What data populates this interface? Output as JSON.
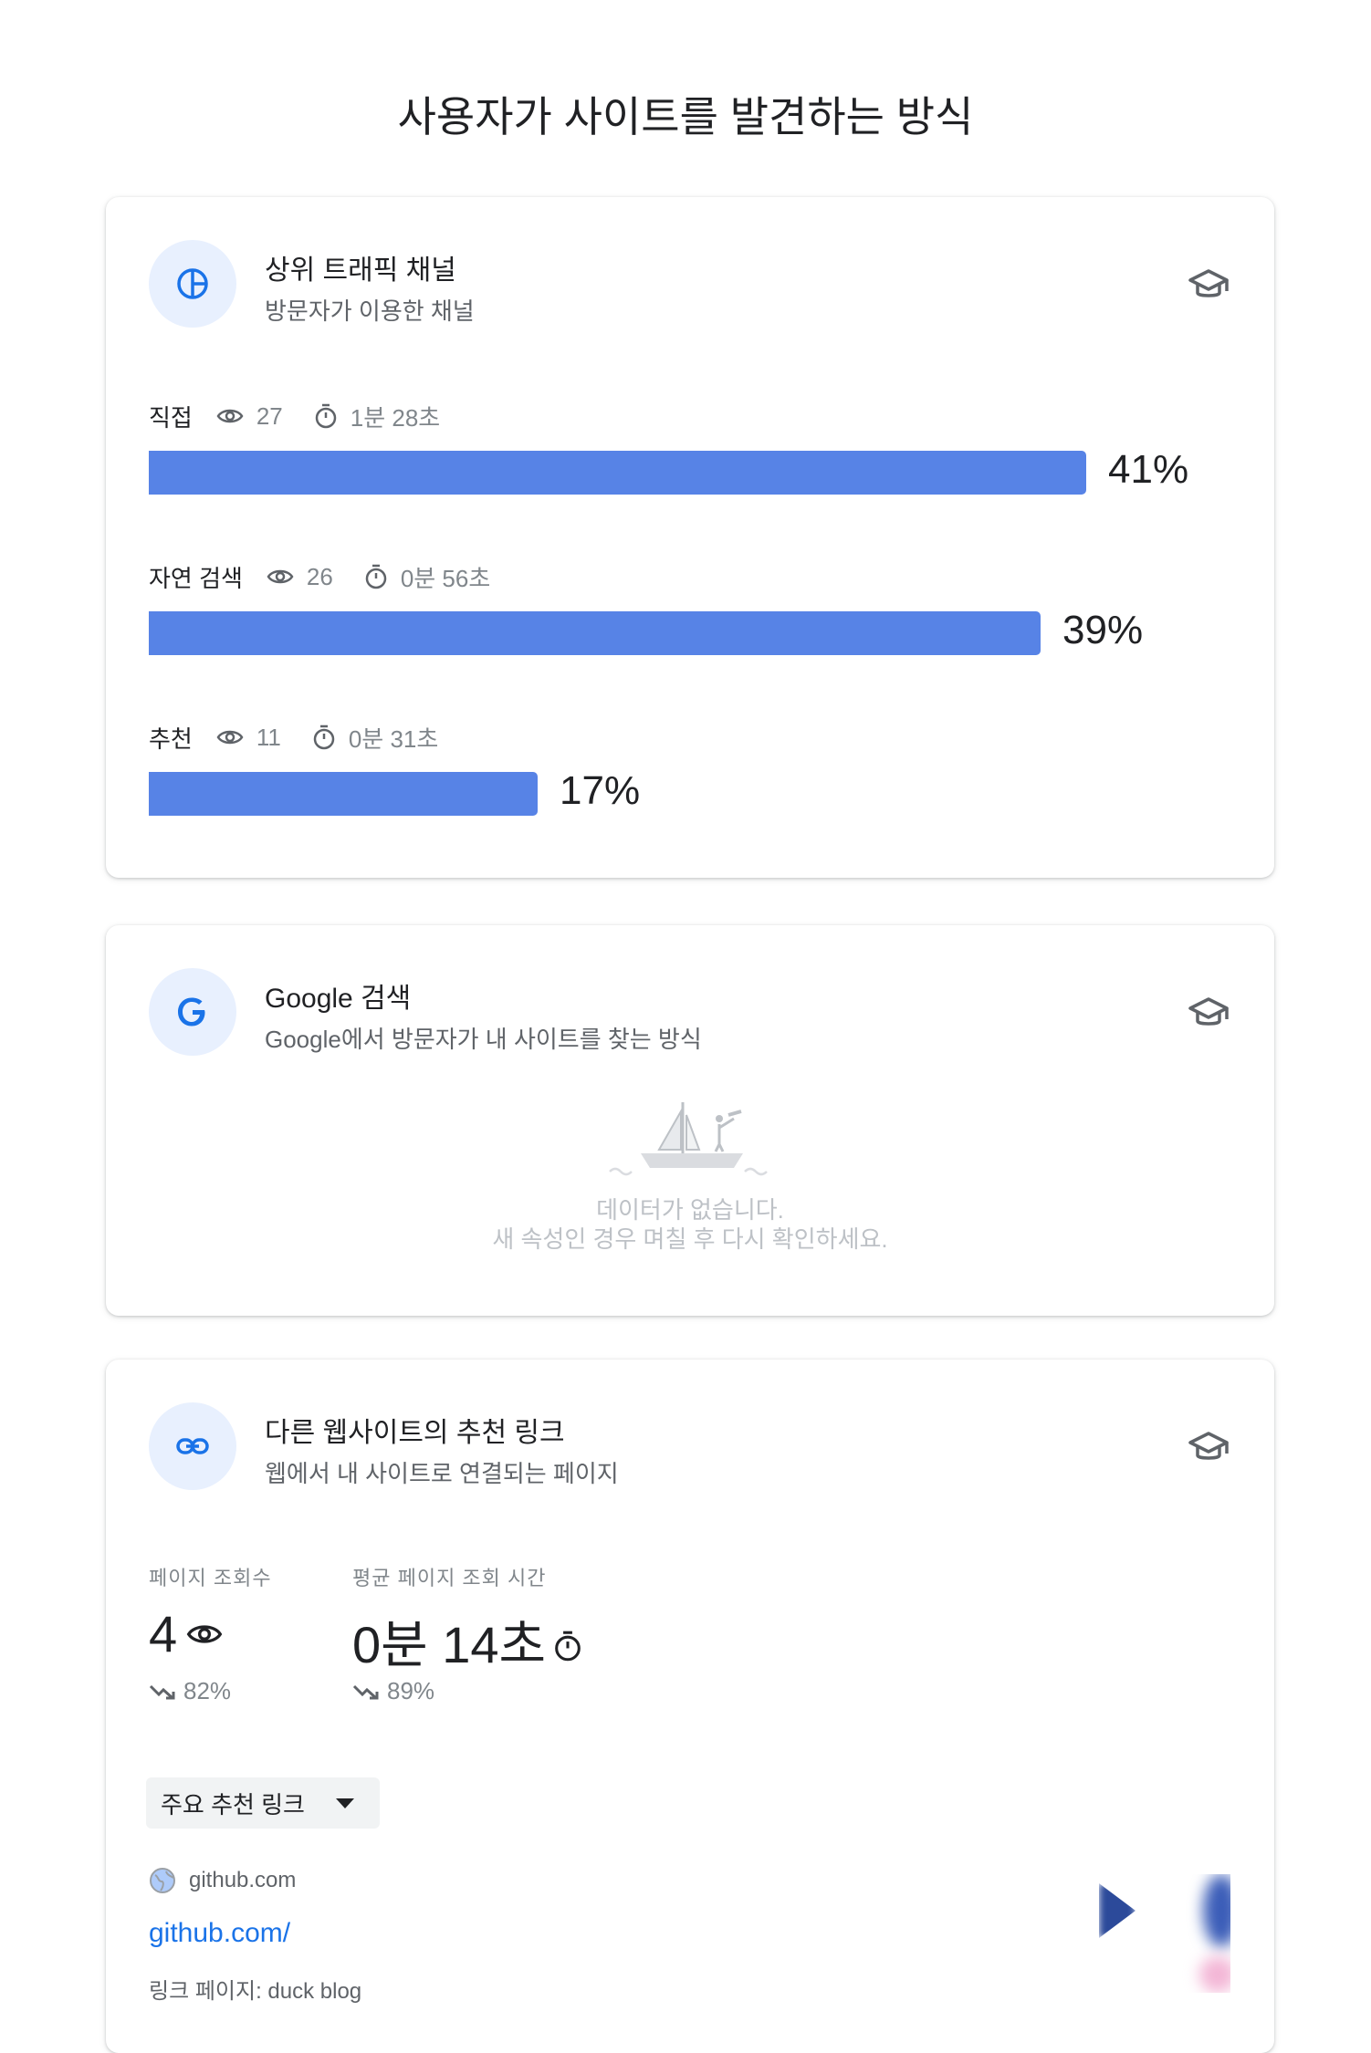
{
  "page": {
    "title": "사용자가 사이트를 발견하는 방식"
  },
  "traffic_card": {
    "title": "상위 트래픽 채널",
    "subtitle": "방문자가 이용한 채널",
    "channels": [
      {
        "name": "직접",
        "views": "27",
        "time": "1분 28초",
        "percent_label": "41%",
        "percent": 41
      },
      {
        "name": "자연 검색",
        "views": "26",
        "time": "0분 56초",
        "percent_label": "39%",
        "percent": 39
      },
      {
        "name": "추천",
        "views": "11",
        "time": "0분 31초",
        "percent_label": "17%",
        "percent": 17
      }
    ],
    "colors": {
      "bar": "#5783e6",
      "icon_bg": "#e8f0fe",
      "icon": "#1a73e8"
    }
  },
  "google_card": {
    "title": "Google 검색",
    "subtitle": "Google에서 방문자가 내 사이트를 찾는 방식",
    "empty_line1": "데이터가 없습니다.",
    "empty_line2": "새 속성인 경우 며칠 후 다시 확인하세요."
  },
  "referral_card": {
    "title": "다른 웹사이트의 추천 링크",
    "subtitle": "웹에서 내 사이트로 연결되는 페이지",
    "pageviews": {
      "label": "페이지 조회수",
      "value": "4",
      "trend": "82%"
    },
    "avg_time": {
      "label": "평균 페이지 조회 시간",
      "value": "0분 14초",
      "trend": "89%"
    },
    "dropdown": {
      "label": "주요 추천 링크"
    },
    "top_referral": {
      "domain": "github.com",
      "link": "github.com/",
      "sub": "링크 페이지: duck blog"
    }
  },
  "icons": {
    "channel_icon": "pie-chart-icon",
    "google_icon": "google-g-icon",
    "link_icon": "link-icon",
    "learn_icon": "graduation-cap-icon",
    "views_icon": "eye-icon",
    "time_icon": "stopwatch-icon",
    "trend_icon": "trending-down-icon",
    "empty_icon": "sailboat-illustration-icon",
    "domain_icon": "globe-icon",
    "dropdown_icon": "caret-down-icon"
  }
}
